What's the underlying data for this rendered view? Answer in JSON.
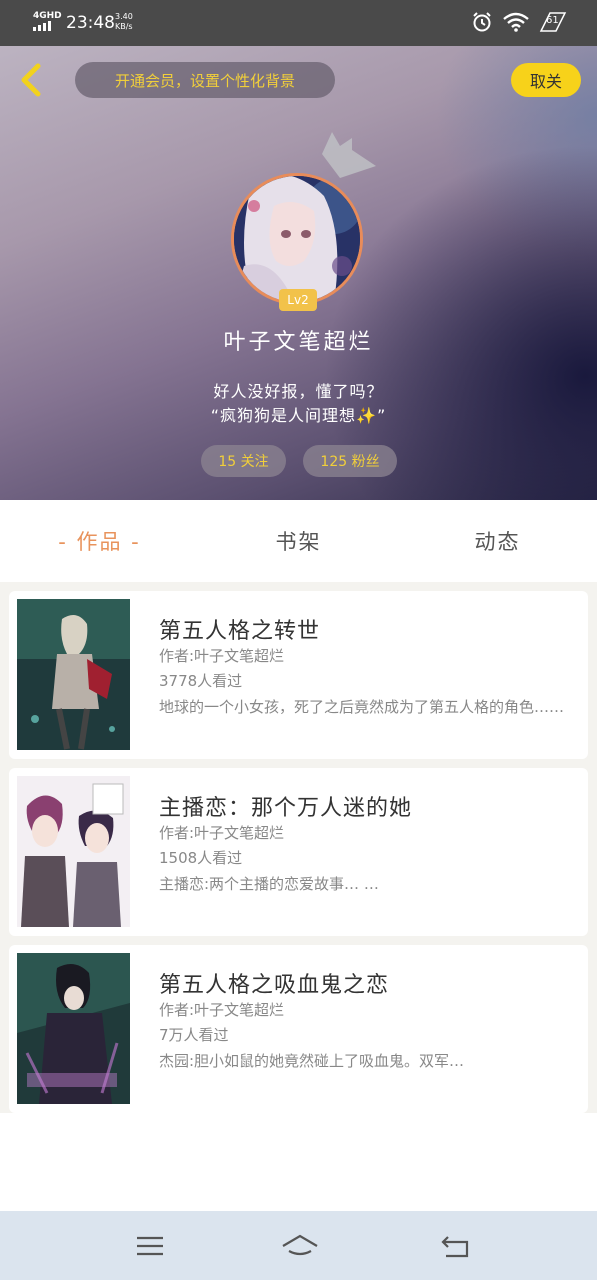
{
  "status_bar": {
    "network": "4GHD",
    "time": "23:48",
    "speed_value": "3.40",
    "speed_unit": "KB/s",
    "battery": "61",
    "icons": [
      "signal-icon",
      "alarm-icon",
      "wifi-icon",
      "battery-icon"
    ]
  },
  "header": {
    "vip_banner": "开通会员，设置个性化背景",
    "cancel_label": "取关",
    "level": "Lv2",
    "username": "叶子文笔超烂",
    "bio_line1": "好人没好报，懂了吗？",
    "bio_line2": "“疯狗狗是人间理想✨”",
    "following": "15 关注",
    "fans": "125 粉丝"
  },
  "tabs": {
    "works": "作品",
    "shelf": "书架",
    "activity": "动态",
    "active": "works"
  },
  "works": [
    {
      "title": "第五人格之转世",
      "author": "作者:叶子文笔超烂",
      "views": "3778人看过",
      "description": "地球的一个小女孩，死了之后竟然成为了第五人格的角色……"
    },
    {
      "title": "主播恋：那个万人迷的她",
      "author": "作者:叶子文笔超烂",
      "views": "1508人看过",
      "description": "主播恋:两个主播的恋爱故事… …"
    },
    {
      "title": "第五人格之吸血鬼之恋",
      "author": "作者:叶子文笔超烂",
      "views": "7万人看过",
      "description": "杰园:胆小如鼠的她竟然碰上了吸血鬼。双军…"
    }
  ],
  "colors": {
    "accent_orange": "#e8935c",
    "accent_yellow": "#f7d21a",
    "nav_bar": "#dbe4ee"
  }
}
